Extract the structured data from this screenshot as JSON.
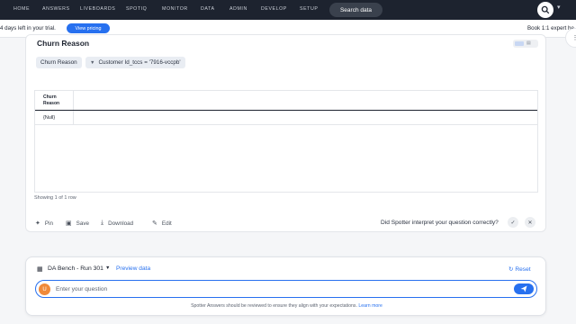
{
  "nav": {
    "items": [
      "HOME",
      "ANSWERS",
      "LIVEBOARDS",
      "SPOTIQ",
      "MONITOR",
      "DATA",
      "ADMIN",
      "DEVELOP",
      "SETUP"
    ],
    "search_label": "Search data",
    "help_icon": "help-circle-icon"
  },
  "trial": {
    "text": "4 days left in your trial.",
    "pricing_label": "View pricing",
    "expert_text": "Book 1:1 expert he"
  },
  "answer": {
    "title": "Churn Reason",
    "chips": [
      {
        "label": "Churn Reason"
      },
      {
        "label": "Customer Id_tccs = '7916-vccpb'"
      }
    ],
    "table": {
      "header": "Churn Reason",
      "rows": [
        "{Null}"
      ]
    },
    "showing": "Showing 1 of 1 row",
    "actions": {
      "pin": "Pin",
      "save": "Save",
      "download": "Download",
      "edit": "Edit"
    },
    "interpret_question": "Did Spotter interpret your question correctly?"
  },
  "spotter": {
    "datasource": "DA Bench - Run 301",
    "preview_label": "Preview data",
    "reset_label": "Reset",
    "avatar_letter": "U",
    "input_placeholder": "Enter your question",
    "disclaimer": "Spotter Answers should be reviewed to ensure they align with your expectations.",
    "learn_more": "Learn more"
  },
  "colors": {
    "nav_bg": "#1d232f",
    "accent": "#2770ef",
    "avatar": "#f08a3a"
  }
}
